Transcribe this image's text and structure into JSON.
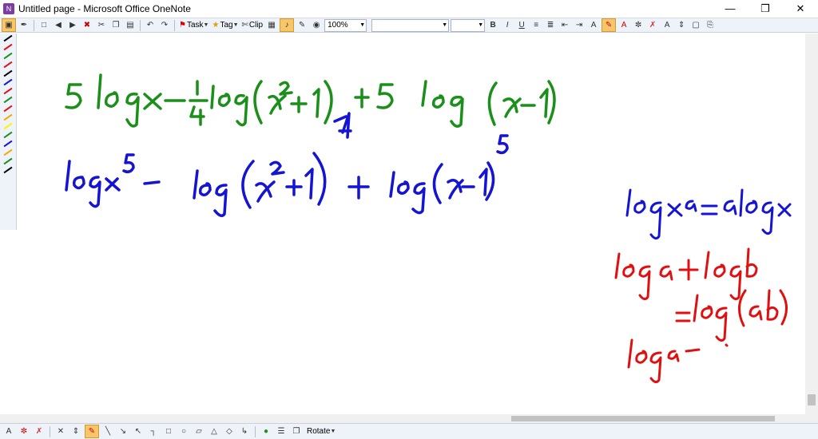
{
  "window": {
    "title": "Untitled page - Microsoft Office OneNote"
  },
  "toolbar": {
    "task_label": "Task",
    "tag_label": "Tag",
    "clip_label": "Clip",
    "zoom_value": "100%",
    "font_value": "",
    "size_value": "",
    "bold": "B",
    "italic": "I",
    "underline": "U"
  },
  "drawbar": {
    "rotate_label": "Rotate"
  },
  "colors": {
    "green_ink": "#1a8f1a",
    "blue_ink": "#1414d2",
    "red_ink": "#e01010",
    "toolbar_bg": "#eef2f9",
    "active_tool": "#f7c66b"
  },
  "pens": [
    "#000000",
    "#e01010",
    "#1a8f1a",
    "#e01010",
    "#000000",
    "#1414d2",
    "#e01010",
    "#1a8f1a",
    "#e01010",
    "#f7a800",
    "#f7f700",
    "#1a8f1a",
    "#1414d2",
    "#f7a800",
    "#1a8f1a",
    "#000000"
  ]
}
